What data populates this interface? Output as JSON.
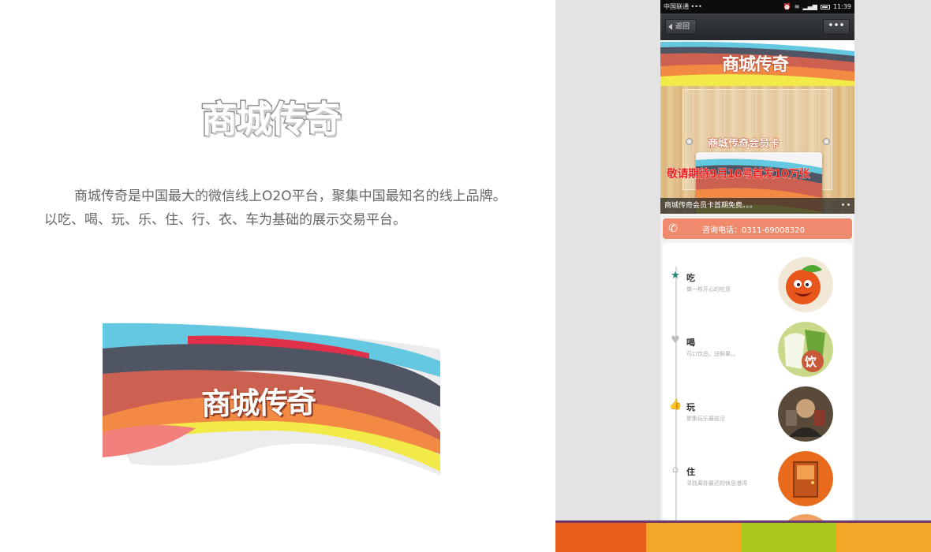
{
  "showcase": {
    "title": "商城传奇",
    "description": "商城传奇是中国最大的微信线上O2O平台，聚集中国最知名的线上品牌。以吃、喝、玩、乐、住、行、衣、车为基础的展示交易平台。",
    "banner_title": "商城传奇"
  },
  "phone": {
    "status": {
      "carrier": "中国联通 •••",
      "time": "11:39"
    },
    "navbar": {
      "back_label": "返回",
      "more_label": "•••"
    },
    "hero": {
      "title": "商城传奇",
      "card_title": "商城传奇会员卡",
      "promo": "敬请期待9月10号首发10万张",
      "caption": "商城传奇会员卡首期免费。。。"
    },
    "contact": {
      "label": "咨询电话：0311-69008320",
      "icon": "phone-icon"
    },
    "menu": [
      {
        "label": "吃",
        "sub": "做一枚开心的吃货",
        "icon": "star-icon",
        "color": "#1f8a6f",
        "img_label": ""
      },
      {
        "label": "喝",
        "sub": "可口饮品，送鲜果。。",
        "icon": "heart-icon",
        "color": "#bdbdbd",
        "img_label": "饮"
      },
      {
        "label": "玩",
        "sub": "聚集玩乐最前沿",
        "icon": "thumbs-up-icon",
        "color": "#1f8a6f",
        "img_label": ""
      },
      {
        "label": "住",
        "sub": "寻找离你最近的休息港湾",
        "icon": "home-icon",
        "color": "#bdbdbd",
        "img_label": ""
      }
    ]
  },
  "colors": {
    "bottom_strip": [
      "#e8601a",
      "#f3a726",
      "#a9c61e",
      "#f3a726"
    ],
    "contact_bar": "#f08a6c"
  }
}
